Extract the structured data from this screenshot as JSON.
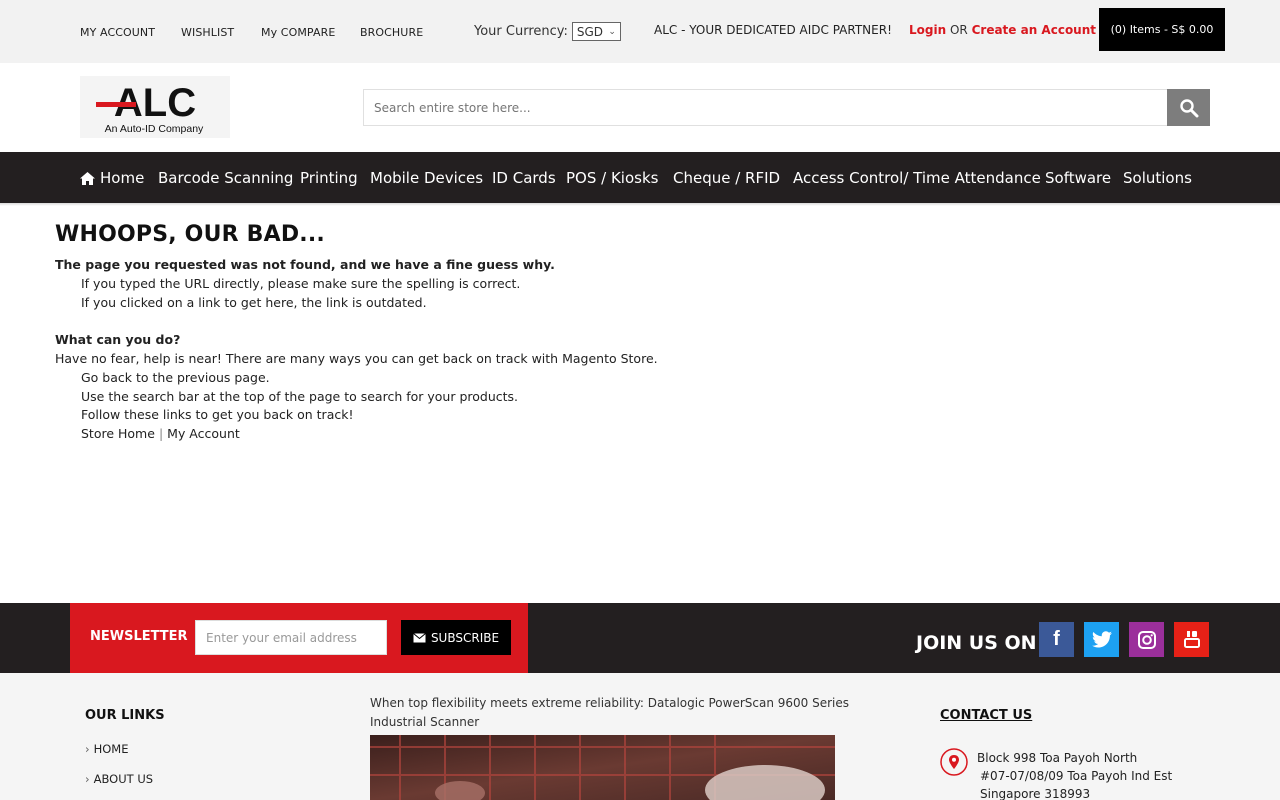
{
  "topbar": {
    "links": [
      "MY ACCOUNT",
      "WISHLIST",
      "My COMPARE",
      "BROCHURE"
    ],
    "currency_label": "Your Currency:",
    "currency_value": "SGD",
    "partner_text": "ALC - YOUR DEDICATED AIDC PARTNER!",
    "login": "Login",
    "or": "OR",
    "create_account": "Create an Account",
    "cart": "(0) Items - S$ 0.00"
  },
  "logo": {
    "brand": "ALC",
    "tagline": "An Auto-ID Company"
  },
  "search": {
    "placeholder": "Search entire store here..."
  },
  "nav": {
    "items": [
      "Home",
      "Barcode Scanning",
      "Printing",
      "Mobile Devices",
      "ID Cards",
      "POS / Kiosks",
      "Cheque / RFID",
      "Access Control/ Time Attendance",
      "Software",
      "Solutions"
    ]
  },
  "content": {
    "heading": "WHOOPS, OUR BAD...",
    "subheading": "The page you requested was not found, and we have a fine guess why.",
    "reasons": [
      "If you typed the URL directly, please make sure the spelling is correct.",
      "If you clicked on a link to get here, the link is outdated."
    ],
    "what_title": "What can you do?",
    "what_text": "Have no fear, help is near! There are many ways you can get back on track with Magento Store.",
    "options": [
      "Go back to the previous page.",
      "Use the search bar at the top of the page to search for your products.",
      "Follow these links to get you back on track!"
    ],
    "store_home": "Store Home",
    "separator": "|",
    "my_account": "My Account"
  },
  "newsletter": {
    "label": "NEWSLETTER",
    "placeholder": "Enter your email address",
    "button": "SUBSCRIBE"
  },
  "social": {
    "join_label": "JOIN US ON :"
  },
  "footer": {
    "links_title": "OUR LINKS",
    "links": [
      "HOME",
      "ABOUT US"
    ],
    "promo_text": "When top flexibility meets extreme reliability: Datalogic PowerScan 9600 Series Industrial Scanner",
    "contact_title": "CONTACT US",
    "address": [
      "Block 998 Toa Payoh North",
      "#07-07/08/09 Toa Payoh Ind Est",
      "Singapore 318993"
    ]
  },
  "colors": {
    "accent_red": "#d9181f",
    "dark_bar": "#231f20",
    "facebook": "#3b5998",
    "twitter": "#1da1f2",
    "instagram": "#9b2f9b",
    "youtube": "#e62117"
  }
}
